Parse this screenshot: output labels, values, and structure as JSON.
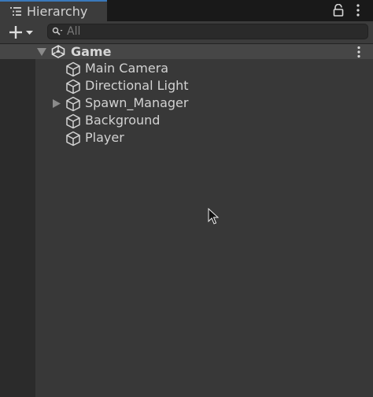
{
  "window": {
    "tab_title": "Hierarchy",
    "tab_icon": "list-icon",
    "lock_icon": "lock-icon",
    "menu_icon": "kebab-menu-icon"
  },
  "toolbar": {
    "create_icon": "plus-dropdown-icon",
    "search_icon": "search-icon",
    "search_placeholder": "All",
    "search_value": ""
  },
  "scene": {
    "name": "Game",
    "icon": "unity-scene-icon",
    "expanded": true,
    "menu_icon": "kebab-menu-icon"
  },
  "items": [
    {
      "label": "Main Camera",
      "icon": "gameobject-cube-icon",
      "has_children": false
    },
    {
      "label": "Directional Light",
      "icon": "gameobject-cube-icon",
      "has_children": false
    },
    {
      "label": "Spawn_Manager",
      "icon": "gameobject-cube-icon",
      "has_children": true
    },
    {
      "label": "Background",
      "icon": "gameobject-cube-icon",
      "has_children": false
    },
    {
      "label": "Player",
      "icon": "gameobject-cube-icon",
      "has_children": false
    }
  ],
  "colors": {
    "tab_accent": "#3a79bb",
    "panel_bg": "#383838",
    "header_bg": "#3c3c3c",
    "text": "#d2d2d2"
  }
}
